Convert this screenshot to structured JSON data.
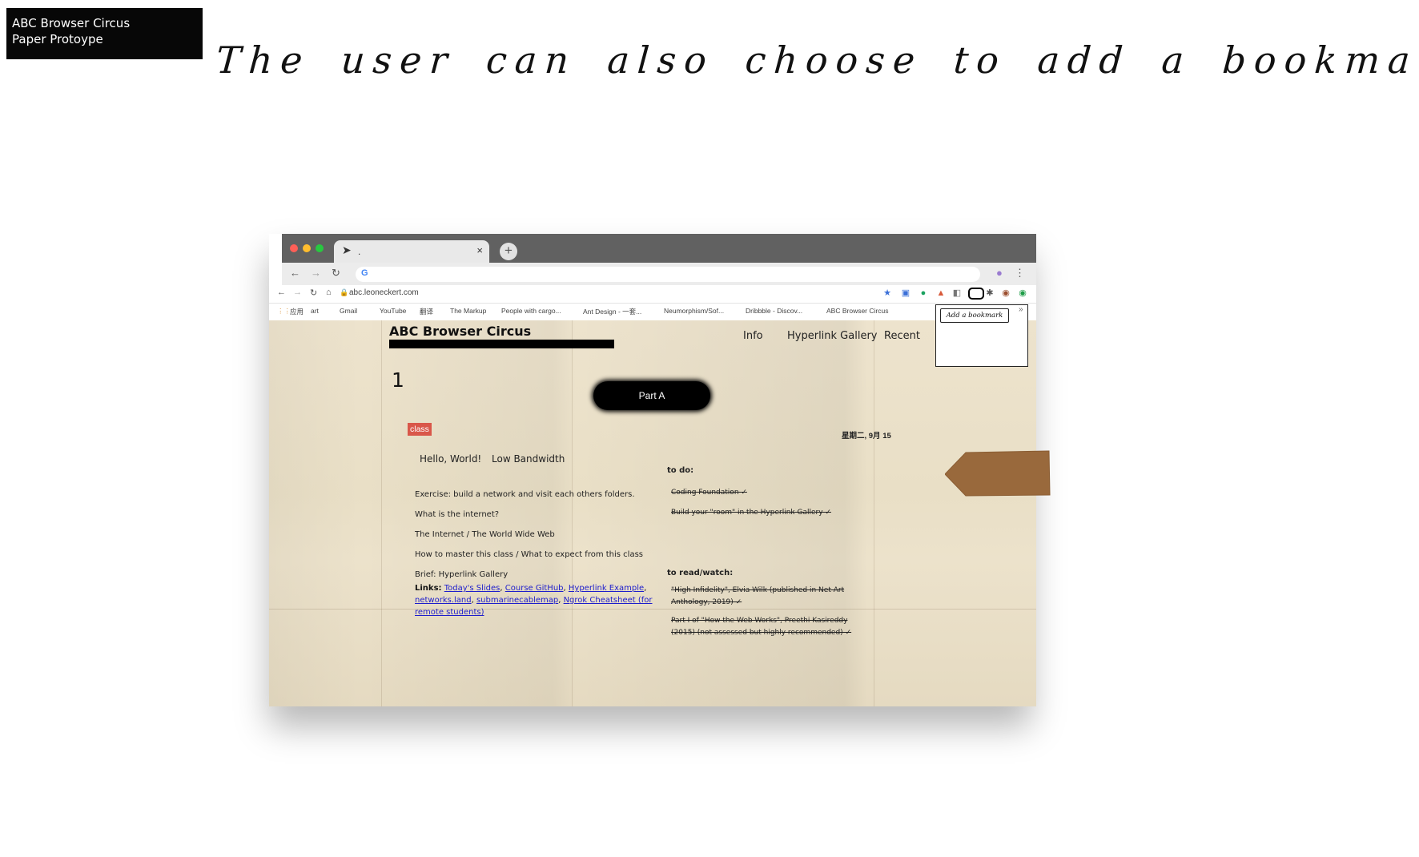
{
  "slide": {
    "badge_line1": "ABC Browser Circus",
    "badge_line2": "Paper Protoype",
    "headline": "The user can also choose to add a bookmark"
  },
  "browser": {
    "tab_title": ".",
    "tab_close": "×",
    "new_tab": "+",
    "omnibox_glyph": "G",
    "url": "abc.leoneckert.com",
    "bookmarks": [
      "应用",
      "art",
      "Gmail",
      "YouTube",
      "翻译",
      "The Markup",
      "People with cargo...",
      "Ant Design - 一套...",
      "Neumorphism/Sof...",
      "Dribbble - Discov...",
      "ABC Browser Circus"
    ],
    "bookmarks_more": "»",
    "popup_button": "Add a bookmark"
  },
  "site": {
    "title": "ABC Browser Circus",
    "nav": [
      "Info",
      "Hyperlink Gallery",
      "Recent"
    ],
    "number": "1",
    "part_button": "Part A",
    "class_tag": "class",
    "date": "星期二, 9月 15",
    "subheads": [
      "Hello, World!",
      "Low Bandwidth"
    ],
    "items": [
      "Exercise: build a network and visit each others folders.",
      "What is the internet?",
      "The Internet / The World Wide Web",
      "How to master this class / What to expect from this class",
      "Brief: Hyperlink Gallery"
    ],
    "links_label": "Links:",
    "links": [
      "Today's Slides",
      "Course GitHub",
      "Hyperlink Example",
      "networks.land",
      "submarinecablemap",
      "Ngrok Cheatsheet (for remote students)"
    ],
    "todo_heading": "to do:",
    "todo": [
      "Coding Foundation ✓",
      "Build your \"room\" in the Hyperlink Gallery ✓"
    ],
    "read_heading": "to read/watch:",
    "read": [
      "\"High Infidelity\", Elvia Wilk (published in Net Art Anthology, 2019) ✓",
      "Part I of \"How the Web Works\", Preethi Kasireddy (2015) (not assessed but highly recommended) ✓"
    ]
  },
  "colors": {
    "badge_bg": "#070707",
    "tabbar": "#616161",
    "class_tag": "#d9574a",
    "link": "#1d1dcc",
    "arrow": "#99693c"
  }
}
